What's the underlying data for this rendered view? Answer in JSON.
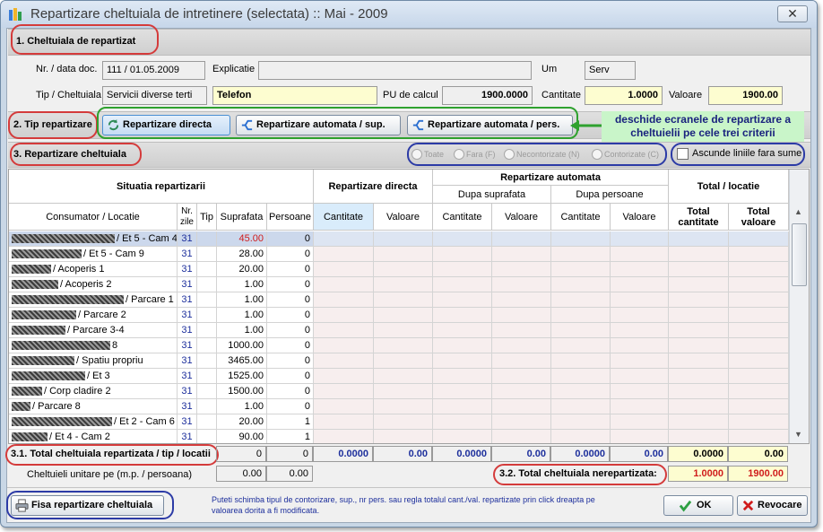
{
  "window": {
    "title": "Repartizare cheltuiala de intretinere (selectata) :: Mai - 2009",
    "close": "✕"
  },
  "section1": {
    "title": "1. Cheltuiala de repartizat",
    "nr_label": "Nr. / data doc.",
    "nr_value": "111 / 01.05.2009",
    "explicatie_label": "Explicatie",
    "explicatie_value": "",
    "um_label": "Um",
    "um_value": "Serv",
    "tip_label": "Tip / Cheltuiala",
    "tip_value": "Servicii diverse terti",
    "cheltuiala_value": "Telefon",
    "pu_label": "PU de calcul",
    "pu_value": "1900.0000",
    "cantitate_label": "Cantitate",
    "cantitate_value": "1.0000",
    "valoare_label": "Valoare",
    "valoare_value": "1900.00"
  },
  "section2": {
    "title": "2. Tip repartizare",
    "btn_directa": "Repartizare directa",
    "btn_auto_sup": "Repartizare automata / sup.",
    "btn_auto_pers": "Repartizare automata / pers.",
    "callout": "deschide ecranele de repartizare a cheltuielii pe cele trei criterii"
  },
  "section3": {
    "title": "3. Repartizare cheltuiala",
    "filters": [
      "Toate",
      "Fara (F)",
      "Necontorizate (N)",
      "Contorizate (C)"
    ],
    "hide_empty": "Ascunde liniile fara sume"
  },
  "grid": {
    "group_headers": {
      "situatia": "Situatia repartizarii",
      "directa": "Repartizare directa",
      "automata": "Repartizare automata",
      "dupa_sup": "Dupa suprafata",
      "dupa_pers": "Dupa persoane",
      "total": "Total / locatie"
    },
    "columns": [
      "Consumator / Locatie",
      "Nr. zile",
      "Tip",
      "Suprafata",
      "Persoane",
      "Cantitate",
      "Valoare",
      "Cantitate",
      "Valoare",
      "Cantitate",
      "Valoare",
      "Total cantitate",
      "Total valoare"
    ],
    "rows": [
      {
        "loc": "/ Et 5 - Cam 4",
        "zile": "31",
        "sup": "45.00",
        "pers": "0"
      },
      {
        "loc": "/ Et 5 - Cam 9",
        "zile": "31",
        "sup": "28.00",
        "pers": "0"
      },
      {
        "loc": "/ Acoperis 1",
        "zile": "31",
        "sup": "20.00",
        "pers": "0"
      },
      {
        "loc": "/ Acoperis 2",
        "zile": "31",
        "sup": "1.00",
        "pers": "0"
      },
      {
        "loc": "/ Parcare 1",
        "zile": "31",
        "sup": "1.00",
        "pers": "0"
      },
      {
        "loc": "/ Parcare 2",
        "zile": "31",
        "sup": "1.00",
        "pers": "0"
      },
      {
        "loc": "/ Parcare 3-4",
        "zile": "31",
        "sup": "1.00",
        "pers": "0"
      },
      {
        "loc": "8",
        "zile": "31",
        "sup": "1000.00",
        "pers": "0"
      },
      {
        "loc": "/ Spatiu propriu",
        "zile": "31",
        "sup": "3465.00",
        "pers": "0"
      },
      {
        "loc": "/ Et 3",
        "zile": "31",
        "sup": "1525.00",
        "pers": "0"
      },
      {
        "loc": "/ Corp cladire 2",
        "zile": "31",
        "sup": "1500.00",
        "pers": "0"
      },
      {
        "loc": "/ Parcare 8",
        "zile": "31",
        "sup": "1.00",
        "pers": "0"
      },
      {
        "loc": "/ Et 2 - Cam 6",
        "zile": "31",
        "sup": "20.00",
        "pers": "1"
      },
      {
        "loc": "/ Et 4 - Cam 2",
        "zile": "31",
        "sup": "90.00",
        "pers": "1"
      }
    ]
  },
  "totals": {
    "label": "3.1. Total cheltuiala repartizata / tip / locatii",
    "sup": "0",
    "pers": "0",
    "dir_cant": "0.0000",
    "dir_val": "0.00",
    "sup_cant": "0.0000",
    "sup_val": "0.00",
    "pers_cant": "0.0000",
    "pers_val": "0.00",
    "tot_cant": "0.0000",
    "tot_val": "0.00",
    "unit_label": "Cheltuieli unitare pe (m.p. / persoana)",
    "unit_sup": "0.00",
    "unit_pers": "0.00",
    "nerep_label": "3.2. Total cheltuiala nerepartizata:",
    "nerep_cant": "1.0000",
    "nerep_val": "1900.00"
  },
  "footer": {
    "fisa": "Fisa repartizare cheltuiala",
    "note": "Puteti schimba tipul de contorizare, sup., nr pers. sau regla totalul cant./val. repartizate prin click dreapta pe valoarea dorita a fi modificata.",
    "ok": "OK",
    "revocare": "Revocare"
  }
}
